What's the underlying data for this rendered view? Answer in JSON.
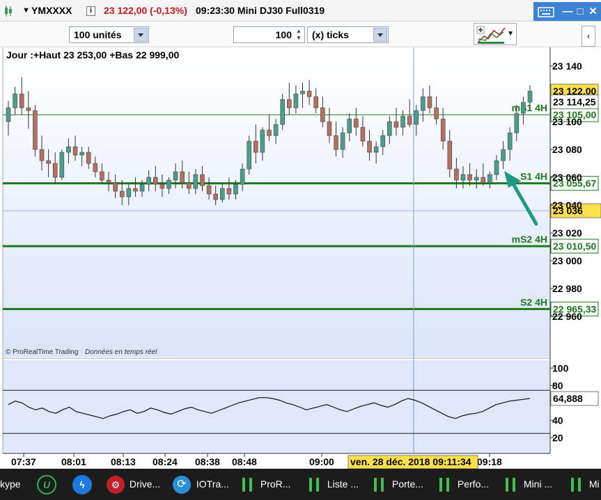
{
  "titlebar": {
    "symbol": "YMXXXX",
    "price_change": "23 122,00 (-0,13%)",
    "info": "09:23:30 Mini DJ30 Full0319"
  },
  "toolbar": {
    "units_value": "100 unités",
    "ticks_count": "100",
    "ticks_label": "(x) ticks"
  },
  "chart": {
    "header": "Jour :+Haut 23 253,00 +Bas 22 999,00",
    "footer_brand": "© ProRealTime Trading",
    "footer_realtime": "Données en temps réel",
    "price_axis_ticks": [
      "23 140",
      "23 100",
      "23 080",
      "23 060",
      "23 040",
      "23 020",
      "23 000",
      "22 980",
      "22 960"
    ],
    "last_price": "23 122,00",
    "second_price": "23 114,25",
    "cursor_price": "23 036",
    "cursor_time": "ven. 28 déc. 2018 09:11:34",
    "levels": [
      {
        "name": "mS1 4H",
        "value": "23 105,00",
        "price": 23105
      },
      {
        "name": "S1 4H",
        "value": "23 055,67",
        "price": 23055.67
      },
      {
        "name": "mS2 4H",
        "value": "23 010,50",
        "price": 23010.5
      },
      {
        "name": "S2 4H",
        "value": "22 965,33",
        "price": 22965.33
      }
    ],
    "oscillator_ticks": [
      "100",
      "80",
      "40",
      "20"
    ],
    "oscillator_value": "64,888",
    "time_labels": [
      "07:37",
      "08:01",
      "08:13",
      "08:24",
      "08:38",
      "08:48",
      "09:00",
      "09:18"
    ],
    "colors": {
      "up": "#4a9e8a",
      "down": "#b5705e",
      "level": "#1a7a1a",
      "highlight": "#ffe04a",
      "accent": "#3d83d4"
    }
  },
  "chart_data": {
    "type": "candlestick",
    "y_range": [
      22950,
      23150
    ],
    "candles": [
      [
        23100,
        23115,
        23090,
        23110
      ],
      [
        23110,
        23125,
        23105,
        23120
      ],
      [
        23120,
        23132,
        23105,
        23110
      ],
      [
        23110,
        23122,
        23095,
        23108
      ],
      [
        23108,
        23112,
        23075,
        23080
      ],
      [
        23080,
        23090,
        23065,
        23072
      ],
      [
        23072,
        23080,
        23060,
        23070
      ],
      [
        23070,
        23078,
        23055,
        23060
      ],
      [
        23060,
        23080,
        23058,
        23078
      ],
      [
        23078,
        23088,
        23070,
        23082
      ],
      [
        23082,
        23090,
        23072,
        23076
      ],
      [
        23076,
        23082,
        23068,
        23078
      ],
      [
        23078,
        23082,
        23066,
        23070
      ],
      [
        23070,
        23075,
        23060,
        23064
      ],
      [
        23064,
        23070,
        23055,
        23058
      ],
      [
        23058,
        23064,
        23050,
        23056
      ],
      [
        23056,
        23062,
        23045,
        23050
      ],
      [
        23050,
        23058,
        23040,
        23046
      ],
      [
        23046,
        23055,
        23040,
        23052
      ],
      [
        23052,
        23060,
        23046,
        23050
      ],
      [
        23050,
        23058,
        23046,
        23055
      ],
      [
        23055,
        23065,
        23050,
        23060
      ],
      [
        23060,
        23068,
        23050,
        23055
      ],
      [
        23055,
        23062,
        23046,
        23052
      ],
      [
        23052,
        23060,
        23048,
        23058
      ],
      [
        23058,
        23070,
        23052,
        23064
      ],
      [
        23064,
        23072,
        23052,
        23056
      ],
      [
        23056,
        23064,
        23048,
        23052
      ],
      [
        23052,
        23066,
        23048,
        23062
      ],
      [
        23062,
        23068,
        23050,
        23054
      ],
      [
        23054,
        23060,
        23044,
        23048
      ],
      [
        23048,
        23054,
        23040,
        23044
      ],
      [
        23044,
        23056,
        23042,
        23052
      ],
      [
        23052,
        23060,
        23044,
        23048
      ],
      [
        23048,
        23058,
        23044,
        23055
      ],
      [
        23055,
        23070,
        23050,
        23066
      ],
      [
        23066,
        23090,
        23062,
        23086
      ],
      [
        23086,
        23098,
        23070,
        23078
      ],
      [
        23078,
        23096,
        23072,
        23094
      ],
      [
        23094,
        23105,
        23086,
        23090
      ],
      [
        23090,
        23102,
        23084,
        23098
      ],
      [
        23098,
        23120,
        23094,
        23116
      ],
      [
        23116,
        23128,
        23105,
        23110
      ],
      [
        23110,
        23126,
        23106,
        23120
      ],
      [
        23120,
        23128,
        23110,
        23122
      ],
      [
        23122,
        23130,
        23112,
        23118
      ],
      [
        23118,
        23124,
        23106,
        23110
      ],
      [
        23110,
        23118,
        23096,
        23100
      ],
      [
        23100,
        23110,
        23085,
        23090
      ],
      [
        23090,
        23100,
        23075,
        23080
      ],
      [
        23080,
        23096,
        23074,
        23092
      ],
      [
        23092,
        23106,
        23086,
        23102
      ],
      [
        23102,
        23110,
        23090,
        23096
      ],
      [
        23096,
        23104,
        23082,
        23086
      ],
      [
        23086,
        23094,
        23072,
        23078
      ],
      [
        23078,
        23086,
        23070,
        23082
      ],
      [
        23082,
        23094,
        23076,
        23090
      ],
      [
        23090,
        23104,
        23084,
        23100
      ],
      [
        23100,
        23110,
        23090,
        23096
      ],
      [
        23096,
        23108,
        23090,
        23104
      ],
      [
        23104,
        23116,
        23096,
        23098
      ],
      [
        23098,
        23112,
        23090,
        23108
      ],
      [
        23108,
        23124,
        23100,
        23118
      ],
      [
        23118,
        23126,
        23106,
        23110
      ],
      [
        23110,
        23118,
        23098,
        23102
      ],
      [
        23102,
        23110,
        23080,
        23086
      ],
      [
        23086,
        23094,
        23060,
        23066
      ],
      [
        23066,
        23074,
        23052,
        23058
      ],
      [
        23058,
        23068,
        23052,
        23062
      ],
      [
        23062,
        23070,
        23054,
        23058
      ],
      [
        23058,
        23066,
        23052,
        23060
      ],
      [
        23060,
        23070,
        23054,
        23056
      ],
      [
        23056,
        23064,
        23052,
        23062
      ],
      [
        23062,
        23076,
        23058,
        23072
      ],
      [
        23072,
        23086,
        23066,
        23080
      ],
      [
        23080,
        23096,
        23072,
        23092
      ],
      [
        23092,
        23112,
        23086,
        23106
      ],
      [
        23106,
        23118,
        23098,
        23114
      ],
      [
        23114,
        23126,
        23108,
        23122
      ]
    ],
    "oscillator": [
      58,
      62,
      60,
      55,
      52,
      54,
      50,
      48,
      52,
      55,
      50,
      48,
      46,
      44,
      42,
      45,
      47,
      50,
      52,
      48,
      50,
      54,
      52,
      49,
      47,
      50,
      53,
      55,
      52,
      50,
      48,
      51,
      54,
      57,
      60,
      62,
      64,
      66,
      66,
      65,
      63,
      60,
      58,
      55,
      52,
      54,
      56,
      58,
      55,
      52,
      50,
      53,
      56,
      58,
      60,
      57,
      55,
      58,
      62,
      65,
      63,
      60,
      56,
      52,
      48,
      44,
      42,
      45,
      47,
      48,
      50,
      54,
      58,
      60,
      62,
      63,
      64,
      65
    ],
    "oscillator_range": [
      0,
      110
    ]
  }
}
